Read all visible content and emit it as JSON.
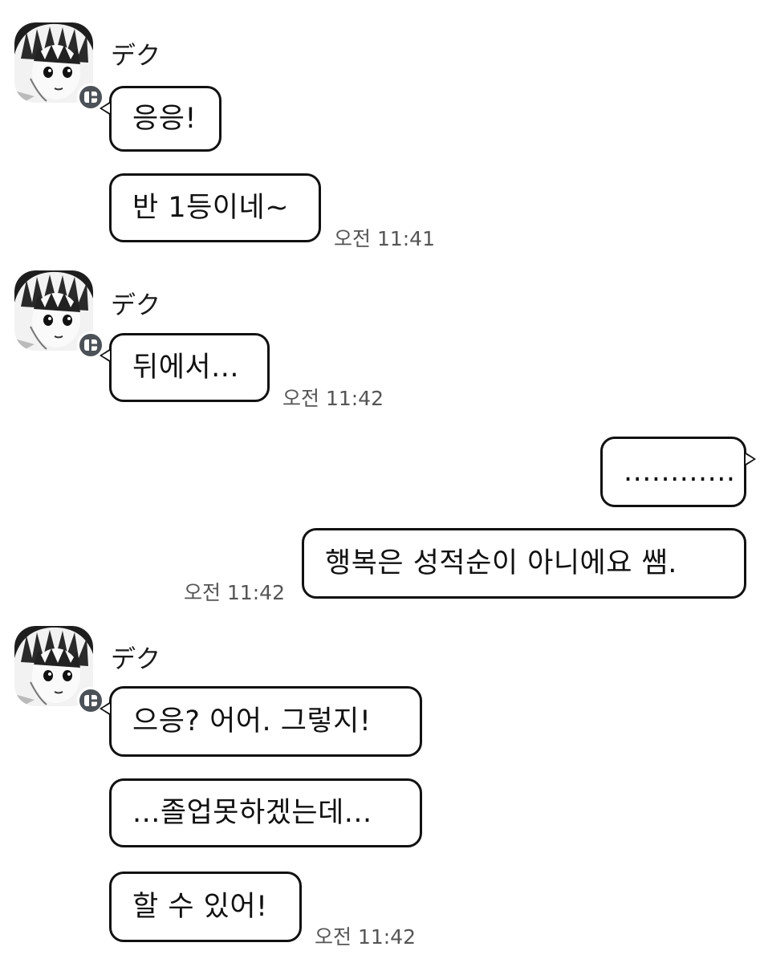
{
  "colors": {
    "background": "#ffffff",
    "bubble_border": "#111111",
    "timestamp": "#555555",
    "badge": "#4b5157"
  },
  "groups": [
    {
      "sender": "デク",
      "avatar_icon": "avatar-image",
      "badge_icon": "app-badge-icon",
      "messages": [
        "응응!",
        "반 1등이네~"
      ],
      "time": "오전 11:41"
    },
    {
      "sender": "デク",
      "avatar_icon": "avatar-image",
      "badge_icon": "app-badge-icon",
      "messages": [
        "뒤에서..."
      ],
      "time": "오전 11:42"
    },
    {
      "sender": "",
      "outgoing": true,
      "messages": [
        "............",
        "행복은 성적순이 아니에요 쌤."
      ],
      "time": "오전 11:42"
    },
    {
      "sender": "デク",
      "avatar_icon": "avatar-image",
      "badge_icon": "app-badge-icon",
      "messages": [
        "으응? 어어. 그렇지!",
        "...졸업못하겠는데...",
        "할 수 있어!"
      ],
      "time": "오전 11:42"
    }
  ]
}
